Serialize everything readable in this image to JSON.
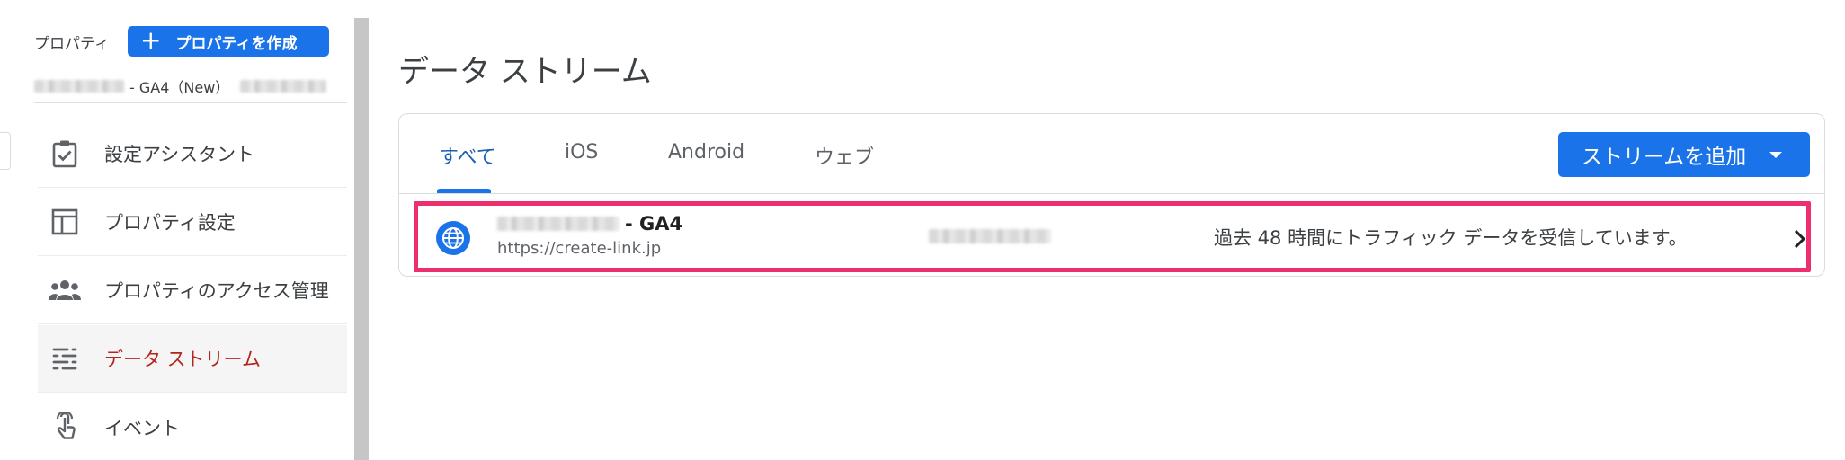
{
  "sidebar": {
    "property_label": "プロパティ",
    "create_button_label": "プロパティを作成",
    "create_button_icon": "plus-icon",
    "property_name_suffix": "- GA4（New）",
    "items": [
      {
        "label": "設定アシスタント",
        "icon": "checklist-icon",
        "active": false
      },
      {
        "label": "プロパティ設定",
        "icon": "layout-icon",
        "active": false
      },
      {
        "label": "プロパティのアクセス管理",
        "icon": "people-icon",
        "active": false
      },
      {
        "label": "データ ストリーム",
        "icon": "streams-icon",
        "active": true
      },
      {
        "label": "イベント",
        "icon": "touch-icon",
        "active": false
      }
    ]
  },
  "main": {
    "title": "データ ストリーム",
    "tabs": [
      {
        "label": "すべて",
        "active": true
      },
      {
        "label": "iOS",
        "active": false
      },
      {
        "label": "Android",
        "active": false
      },
      {
        "label": "ウェブ",
        "active": false
      }
    ],
    "add_stream_button_label": "ストリームを追加",
    "stream": {
      "name_suffix": "- GA4",
      "url": "https://create-link.jp",
      "status": "過去 48 時間にトラフィック データを受信しています。",
      "icon": "globe-icon"
    }
  },
  "colors": {
    "primary": "#1a73e8",
    "active_nav_text": "#b3261e",
    "highlight_border": "#ec2f6f",
    "text": "#3c4043"
  }
}
